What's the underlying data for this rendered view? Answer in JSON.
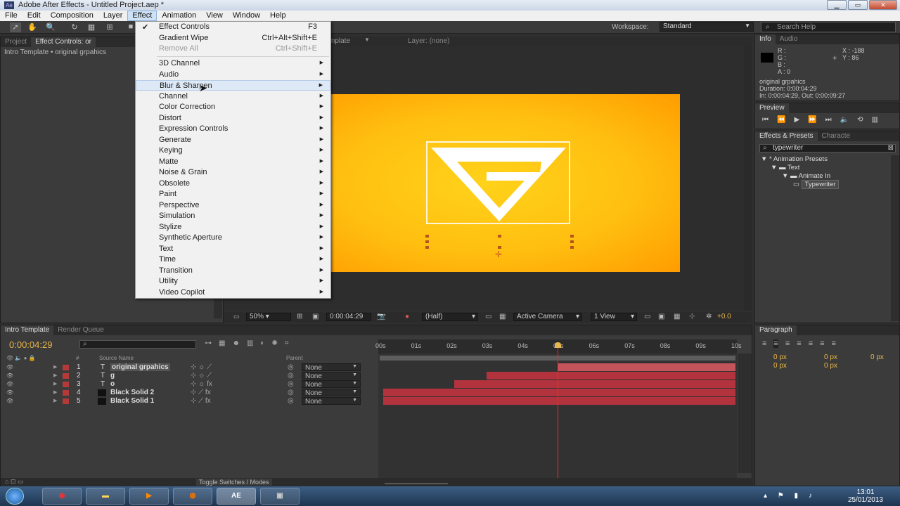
{
  "window": {
    "title": "Adobe After Effects - Untitled Project.aep *"
  },
  "menubar": [
    "File",
    "Edit",
    "Composition",
    "Layer",
    "Effect",
    "Animation",
    "View",
    "Window",
    "Help"
  ],
  "toolbar": {
    "workspace_label": "Workspace:",
    "workspace_value": "Standard",
    "search_placeholder": "Search Help"
  },
  "left_panel": {
    "tabs": [
      "Project",
      "Effect Controls: or"
    ],
    "subtitle": "Intro Template • original grpahics"
  },
  "viewer": {
    "tab_suffix": "mplate",
    "layer_tab": "Layer: (none)",
    "zoom": "50%",
    "timecode": "0:00:04:29",
    "resolution": "(Half)",
    "camera": "Active Camera",
    "views": "1 View",
    "exposure": "+0.0"
  },
  "effect_menu": {
    "items": [
      {
        "label": "Effect Controls",
        "shortcut": "F3",
        "checked": true
      },
      {
        "label": "Gradient Wipe",
        "shortcut": "Ctrl+Alt+Shift+E"
      },
      {
        "label": "Remove All",
        "shortcut": "Ctrl+Shift+E",
        "disabled": true
      },
      {
        "label": "3D Channel",
        "sub": true
      },
      {
        "label": "Audio",
        "sub": true
      },
      {
        "label": "Blur & Sharpen",
        "sub": true,
        "hover": true
      },
      {
        "label": "Channel",
        "sub": true
      },
      {
        "label": "Color Correction",
        "sub": true
      },
      {
        "label": "Distort",
        "sub": true
      },
      {
        "label": "Expression Controls",
        "sub": true
      },
      {
        "label": "Generate",
        "sub": true
      },
      {
        "label": "Keying",
        "sub": true
      },
      {
        "label": "Matte",
        "sub": true
      },
      {
        "label": "Noise & Grain",
        "sub": true
      },
      {
        "label": "Obsolete",
        "sub": true
      },
      {
        "label": "Paint",
        "sub": true
      },
      {
        "label": "Perspective",
        "sub": true
      },
      {
        "label": "Simulation",
        "sub": true
      },
      {
        "label": "Stylize",
        "sub": true
      },
      {
        "label": "Synthetic Aperture",
        "sub": true
      },
      {
        "label": "Text",
        "sub": true
      },
      {
        "label": "Time",
        "sub": true
      },
      {
        "label": "Transition",
        "sub": true
      },
      {
        "label": "Utility",
        "sub": true
      },
      {
        "label": "Video Copilot",
        "sub": true
      }
    ]
  },
  "info_panel": {
    "tabs": [
      "Info",
      "Audio"
    ],
    "r": "R :",
    "g": "G :",
    "b": "B :",
    "a": "A : 0",
    "x": "X : -188",
    "y": "Y : 86",
    "layer": "original grpahics",
    "duration": "Duration: 0:00:04:29",
    "inout": "In: 0:00:04:29, Out: 0:00:09:27"
  },
  "preview_panel": {
    "tab": "Preview"
  },
  "effects_presets": {
    "tabs": [
      "Effects & Presets",
      "Characte"
    ],
    "search": "typewriter",
    "tree": [
      "* Animation Presets",
      "Text",
      "Animate In",
      "Typewriter"
    ]
  },
  "paragraph_panel": {
    "tab": "Paragraph",
    "values": [
      "0 px",
      "0 px",
      "0 px",
      "0 px",
      "0 px"
    ]
  },
  "timeline": {
    "tabs": [
      "Intro Template",
      "Render Queue"
    ],
    "timecode": "0:00:04:29",
    "header_source": "Source Name",
    "header_parent": "Parent",
    "header_hash": "#",
    "ruler": [
      "00s",
      "01s",
      "02s",
      "03s",
      "04s",
      "05s",
      "06s",
      "07s",
      "08s",
      "09s",
      "10s"
    ],
    "footer": "Toggle Switches / Modes",
    "layers": [
      {
        "num": "1",
        "type": "T",
        "name": "original grpahics",
        "parent": "None",
        "color": "#b43a3a",
        "start": 5.0,
        "end": 10.0
      },
      {
        "num": "2",
        "type": "T",
        "name": "g",
        "parent": "None",
        "color": "#b43a3a",
        "start": 3.0,
        "end": 10.0
      },
      {
        "num": "3",
        "type": "T",
        "name": "o",
        "parent": "None",
        "color": "#b43a3a",
        "start": 2.1,
        "end": 10.0
      },
      {
        "num": "4",
        "type": "",
        "name": "Black Solid 2",
        "parent": "None",
        "color": "#b43a3a",
        "start": 0.1,
        "end": 10.0
      },
      {
        "num": "5",
        "type": "",
        "name": "Black Solid 1",
        "parent": "None",
        "color": "#b43a3a",
        "start": 0.1,
        "end": 10.0
      }
    ],
    "playhead_seconds": 5.0
  },
  "taskbar": {
    "ae_label": "AE",
    "time": "13:01",
    "date": "25/01/2013"
  }
}
